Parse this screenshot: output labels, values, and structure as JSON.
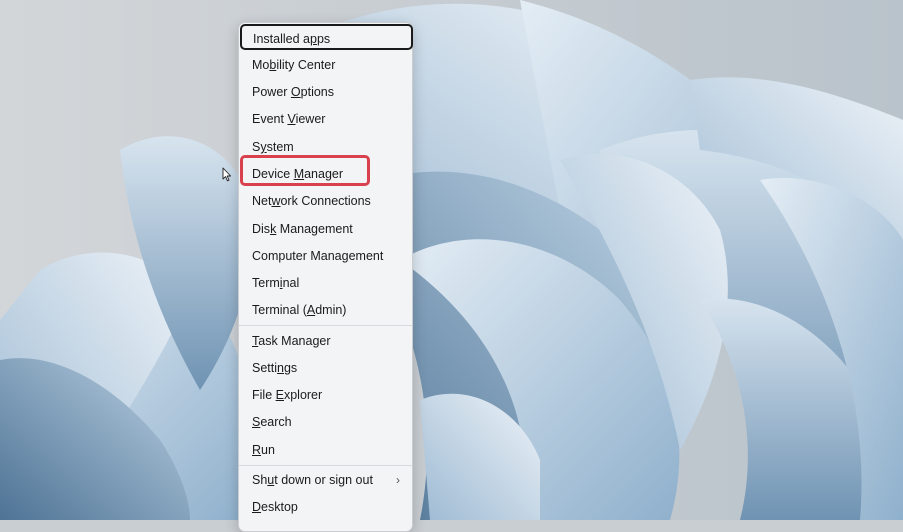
{
  "menu": {
    "items": [
      {
        "pre": "Installed a",
        "u": "p",
        "post": "ps"
      },
      {
        "pre": "Mo",
        "u": "b",
        "post": "ility Center"
      },
      {
        "pre": "Power ",
        "u": "O",
        "post": "ptions"
      },
      {
        "pre": "Event ",
        "u": "V",
        "post": "iewer"
      },
      {
        "pre": "S",
        "u": "y",
        "post": "stem"
      },
      {
        "pre": "Device ",
        "u": "M",
        "post": "anager"
      },
      {
        "pre": "Net",
        "u": "w",
        "post": "ork Connections"
      },
      {
        "pre": "Dis",
        "u": "k",
        "post": " Management"
      },
      {
        "pre": "Computer Mana",
        "u": "g",
        "post": "ement"
      },
      {
        "pre": "Term",
        "u": "i",
        "post": "nal"
      },
      {
        "pre": "Terminal (",
        "u": "A",
        "post": "dmin)"
      },
      {
        "pre": "",
        "u": "T",
        "post": "ask Manager"
      },
      {
        "pre": "Setti",
        "u": "n",
        "post": "gs"
      },
      {
        "pre": "File ",
        "u": "E",
        "post": "xplorer"
      },
      {
        "pre": "",
        "u": "S",
        "post": "earch"
      },
      {
        "pre": "",
        "u": "R",
        "post": "un"
      },
      {
        "pre": "Sh",
        "u": "u",
        "post": "t down or sign out"
      },
      {
        "pre": "",
        "u": "D",
        "post": "esktop"
      }
    ],
    "submenu_chevron": "›"
  },
  "highlight": {
    "target": "Device Manager",
    "color": "#d9414f"
  },
  "colors": {
    "menu_bg": "#f3f4f6",
    "wallpaper_bg": "#c9ced3",
    "bloom": "#8fb0cc"
  },
  "icons": {
    "pointer": "mouse-pointer-icon",
    "chevron": "chevron-right-icon"
  }
}
